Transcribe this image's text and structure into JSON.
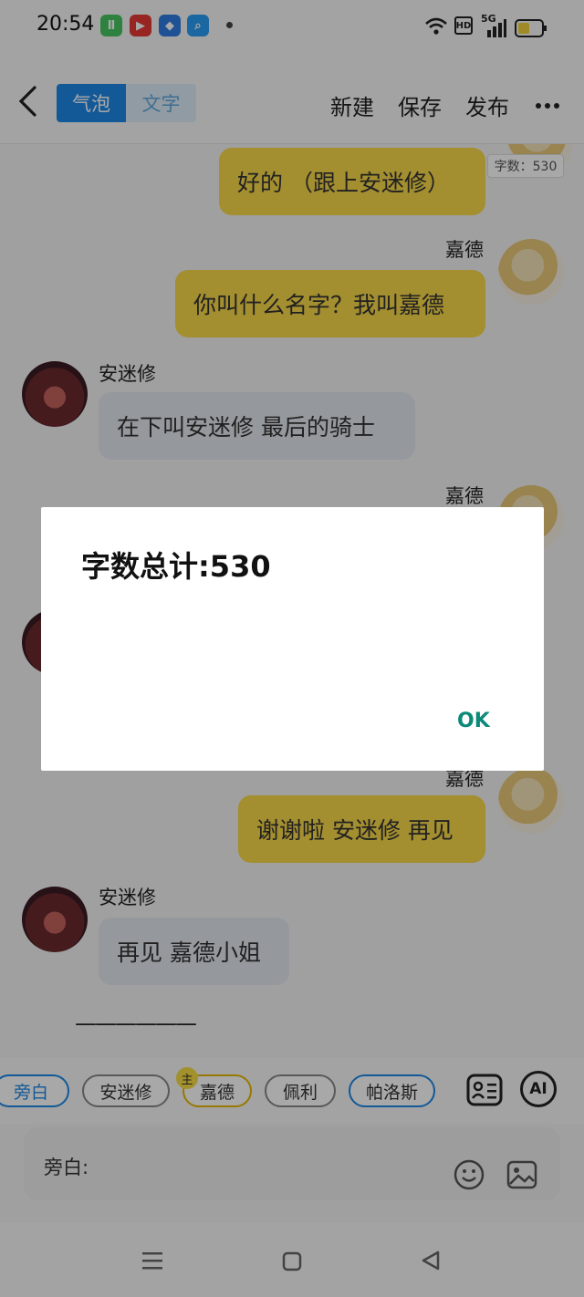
{
  "status_bar": {
    "time": "20:54",
    "network": "5G",
    "hd": "HD"
  },
  "header": {
    "tab_bubble": "气泡",
    "tab_text": "文字",
    "new_label": "新建",
    "save_label": "保存",
    "publish_label": "发布"
  },
  "chat": {
    "word_count_badge": "字数：530",
    "messages": [
      {
        "speaker": "",
        "text": "好的 （跟上安迷修）"
      },
      {
        "speaker": "嘉德",
        "text": "你叫什么名字？我叫嘉德"
      },
      {
        "speaker": "安迷修",
        "text": "在下叫安迷修 最后的骑士"
      },
      {
        "speaker": "嘉德",
        "text": ""
      },
      {
        "speaker": "嘉德",
        "text": "谢谢啦 安迷修 再见"
      },
      {
        "speaker": "安迷修",
        "text": "再见 嘉德小姐"
      }
    ],
    "divider": "——————"
  },
  "characters": {
    "chips": [
      "旁白",
      "安迷修",
      "嘉德",
      "佩利",
      "帕洛斯"
    ],
    "main_marker": "主",
    "ai_label": "AI"
  },
  "input": {
    "label": "旁白:"
  },
  "dialog": {
    "title": "字数总计:530",
    "ok_label": "OK"
  }
}
